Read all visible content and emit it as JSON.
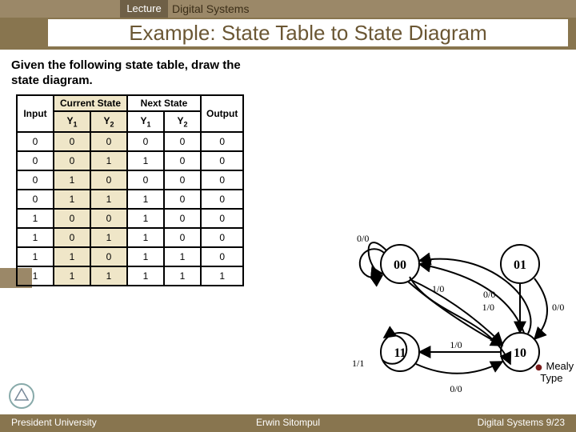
{
  "header": {
    "lecture_label": "Lecture",
    "course_name": "Digital Systems",
    "title": "Example: State Table to State Diagram"
  },
  "prompt": "Given the following state table, draw the state diagram.",
  "table": {
    "col_input": "Input",
    "grp_current": "Current State",
    "grp_next": "Next State",
    "col_output": "Output",
    "y1": "Y",
    "y1_sub": "1",
    "y2": "Y",
    "y2_sub": "2",
    "rows": [
      {
        "in": "0",
        "cy1": "0",
        "cy2": "0",
        "ny1": "0",
        "ny2": "0",
        "out": "0"
      },
      {
        "in": "0",
        "cy1": "0",
        "cy2": "1",
        "ny1": "1",
        "ny2": "0",
        "out": "0"
      },
      {
        "in": "0",
        "cy1": "1",
        "cy2": "0",
        "ny1": "0",
        "ny2": "0",
        "out": "0"
      },
      {
        "in": "0",
        "cy1": "1",
        "cy2": "1",
        "ny1": "1",
        "ny2": "0",
        "out": "0"
      },
      {
        "in": "1",
        "cy1": "0",
        "cy2": "0",
        "ny1": "1",
        "ny2": "0",
        "out": "0"
      },
      {
        "in": "1",
        "cy1": "0",
        "cy2": "1",
        "ny1": "1",
        "ny2": "0",
        "out": "0"
      },
      {
        "in": "1",
        "cy1": "1",
        "cy2": "0",
        "ny1": "1",
        "ny2": "1",
        "out": "0"
      },
      {
        "in": "1",
        "cy1": "1",
        "cy2": "1",
        "ny1": "1",
        "ny2": "1",
        "out": "1"
      }
    ]
  },
  "diagram": {
    "states": {
      "s00": "00",
      "s01": "01",
      "s10": "10",
      "s11": "11"
    },
    "edges": {
      "e00_self": "0/0",
      "e00_10": "1/0",
      "e01_10": "1/0",
      "e01_10b": "0/0",
      "e11_10": "0/0",
      "e10_11": "1/0",
      "e10_00": "0/0",
      "e11_self": "1/1"
    }
  },
  "mealy_note": {
    "bullet": "●",
    "line1": "Mealy",
    "line2": "Type"
  },
  "footer": {
    "left": "President University",
    "center": "Erwin Sitompul",
    "right": "Digital Systems 9/23"
  }
}
